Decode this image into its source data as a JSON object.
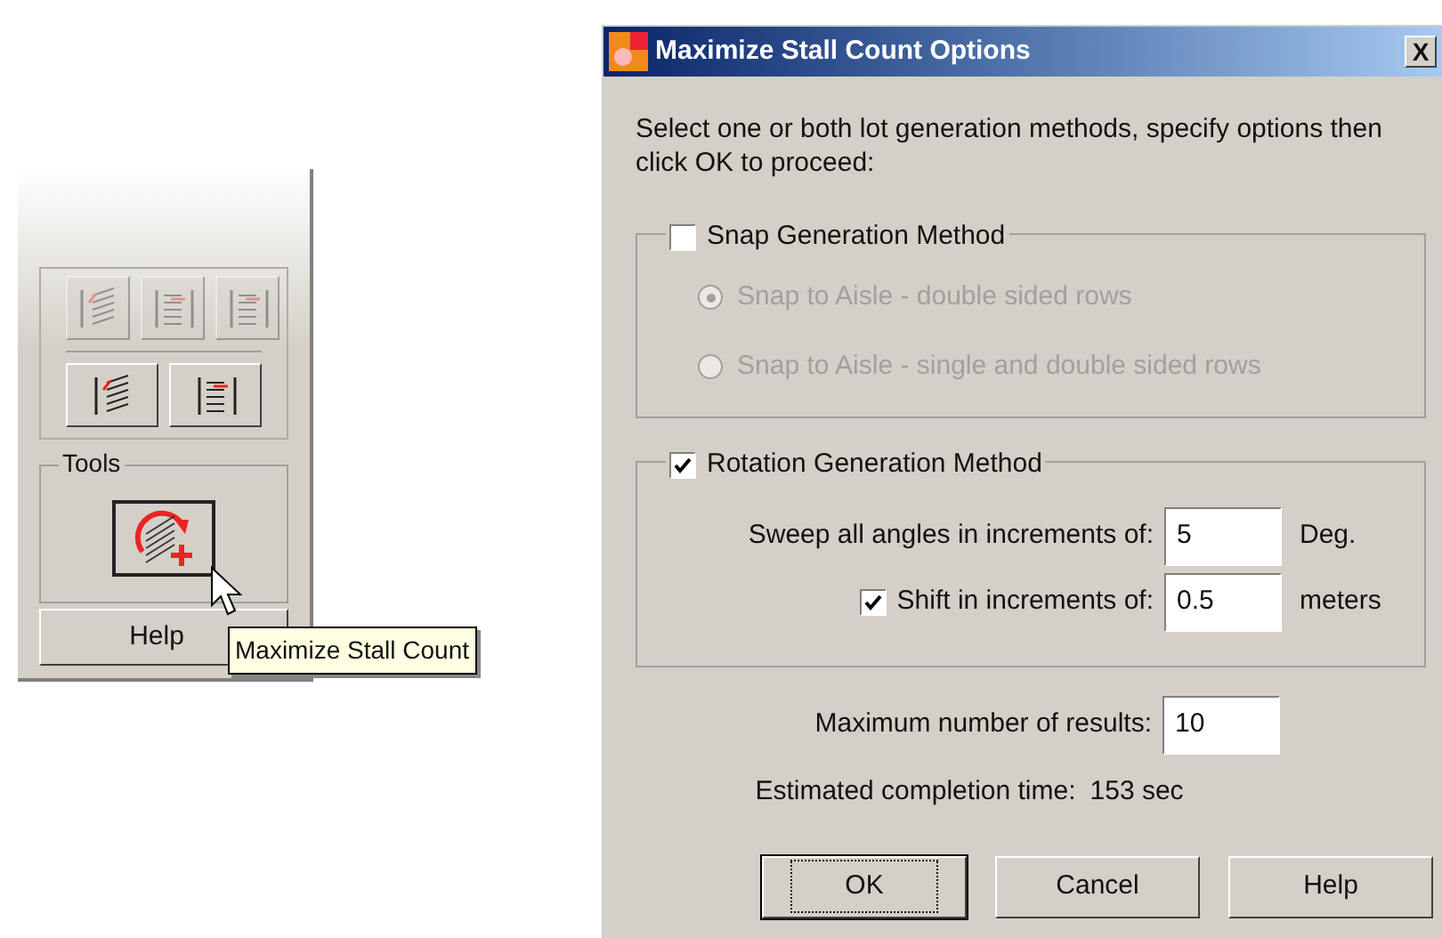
{
  "toolbar": {
    "tools_group": {
      "title": "Tools"
    },
    "help_button": "Help",
    "tooltip": "Maximize Stall Count"
  },
  "dialog": {
    "title": "Maximize Stall Count Options",
    "close": "X",
    "intro": "Select one or both lot generation methods, specify options then click OK to proceed:",
    "snap_group": {
      "label": "Snap Generation Method",
      "checked": false,
      "options": [
        {
          "label": "Snap to Aisle - double sided rows",
          "selected": true
        },
        {
          "label": "Snap to Aisle - single and double sided rows",
          "selected": false
        }
      ]
    },
    "rotation_group": {
      "label": "Rotation Generation Method",
      "checked": true,
      "sweep": {
        "label": "Sweep all angles in increments of:",
        "value": "5",
        "unit": "Deg."
      },
      "shift": {
        "label": "Shift in increments of:",
        "checked": true,
        "value": "0.5",
        "unit": "meters"
      }
    },
    "max_results": {
      "label": "Maximum number of results:",
      "value": "10"
    },
    "estimate": {
      "label": "Estimated completion time:",
      "value": "153 sec"
    },
    "buttons": [
      {
        "label": "OK",
        "default": true
      },
      {
        "label": "Cancel",
        "default": false
      },
      {
        "label": "Help",
        "default": false
      }
    ]
  }
}
